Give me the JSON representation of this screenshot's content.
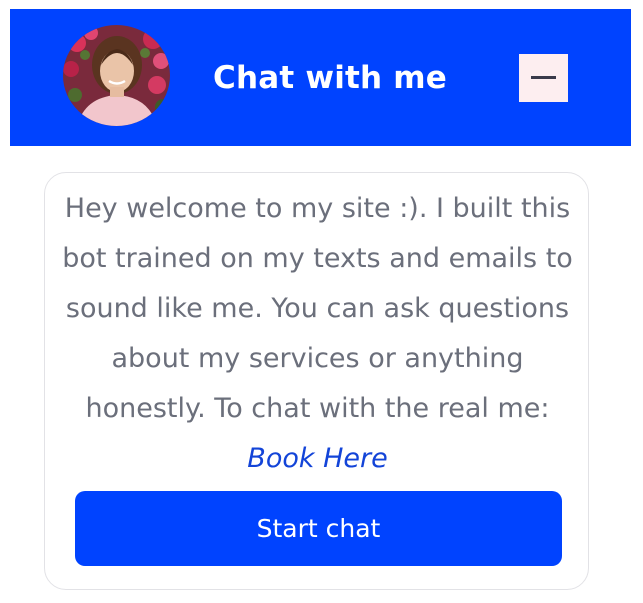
{
  "header": {
    "title": "Chat with me",
    "bg_color": "#0043ff",
    "minimize_icon": "minus-icon"
  },
  "welcome": {
    "message": "Hey welcome to my site :). I built this bot trained on my texts and emails to sound like me. You can ask questions about my services or anything honestly. To chat with the real me: ",
    "link_label": "Book Here",
    "button_label": "Start chat"
  },
  "colors": {
    "accent": "#0043ff",
    "link": "#1344d8",
    "body_text": "#6b6f7b",
    "minimize_bg": "#fdeef0"
  }
}
